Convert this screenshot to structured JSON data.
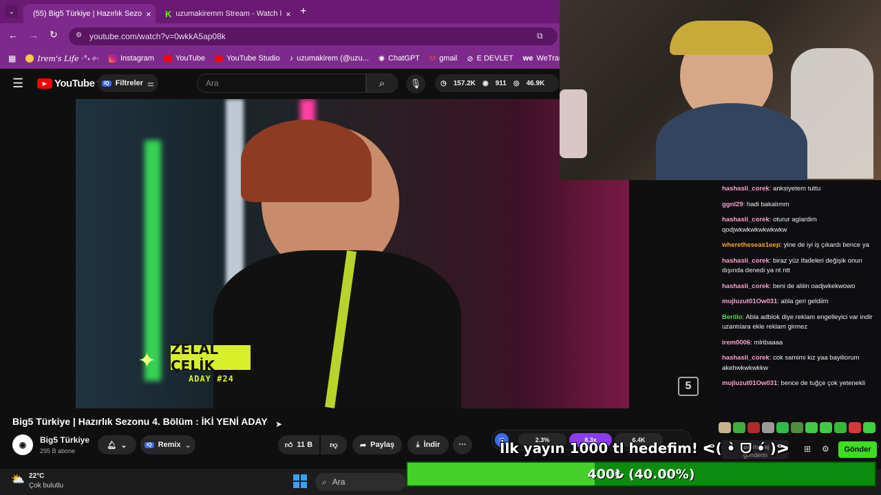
{
  "browser": {
    "tabs": [
      {
        "title": "(55) Big5 Türkiye | Hazırlık Sezo",
        "close": "×"
      },
      {
        "title": "uzumakiremm Stream - Watch l",
        "close": "×"
      }
    ],
    "new_tab": "+",
    "url": "youtube.com/watch?v=0wkkA5ap08k",
    "bookmarks": [
      "Irem's Life ·°˖✧·",
      "Instagram",
      "YouTube",
      "YouTube Studio",
      "uzumakirem (@uzu...",
      "ChatGPT",
      "gmail",
      "E DEVLET",
      "WeTransfe"
    ]
  },
  "youtube": {
    "logo": "YouTube",
    "logo_region": "TR",
    "filters_label": "Filtreler",
    "search_placeholder": "Ara",
    "stats": {
      "likes": "157.2K",
      "views": "911",
      "watching": "46.9K"
    },
    "video": {
      "name_tag": "ZELAL ÇELİK",
      "aday_tag": "ADAY #24",
      "title": "Big5 Türkiye | Hazırlık Sezonu 4. Bölüm : İKİ YENİ ADAY",
      "channel": "Big5 Türkiye",
      "subscribers": "295 B abone",
      "remix": "Remix",
      "like_count": "11 B",
      "share": "Paylaş",
      "download": "İndir",
      "more": "···"
    }
  },
  "overlay_stats": {
    "a": "2.3%",
    "b": "8.3x",
    "c": "6.4K"
  },
  "chat": {
    "messages": [
      {
        "user": "hashasli_corek",
        "text": "anksiyetem tuttu",
        "color": "#ff9fd3"
      },
      {
        "user": "ggnl29",
        "text": "hadi bakalımm",
        "color": "#ff9fd3"
      },
      {
        "user": "hashasli_corek",
        "text": "oturur aglardim qodjwkwkwkwkwkwkw",
        "color": "#ff9fd3"
      },
      {
        "user": "wheretheseas1eep",
        "text": "yine de iyi iş çıkardı bence ya",
        "color": "#f5a623"
      },
      {
        "user": "hashasli_corek",
        "text": "biraz yüz ifadeleri değişik onun dışında denedi ya nt ntt",
        "color": "#ff9fd3"
      },
      {
        "user": "hashasli_corek",
        "text": "beni de aliiin oadjwkekwowo",
        "color": "#ff9fd3"
      },
      {
        "user": "mujluzut01Ow031",
        "text": "abla geri geldiim",
        "color": "#ff9fd3"
      },
      {
        "user": "Berillo",
        "text": "Abla adblok diye reklam engelleyici var indir uzantılara ekle reklam girmez",
        "color": "#52d64a"
      },
      {
        "user": "irem0006",
        "text": "mlribaaaa",
        "color": "#ff9fd3"
      },
      {
        "user": "hashasli_corek",
        "text": "cok samimi kiz yaa bayiliorum akehwkwkwkkw",
        "color": "#ff9fd3"
      },
      {
        "user": "mujluzut01Ow031",
        "text": "bence de tuğçe çok yetenekli",
        "color": "#ff9fd3"
      }
    ],
    "input_placeholder": "Bir mesaj gönderin",
    "send": "Gönder"
  },
  "goal": {
    "text": "İlk yayın 1000 tl hedefim! ᕙ( •̀ ᗜ •́ )ᕗ",
    "progress_label": "400₺ (40.00%)",
    "progress_fraction": 0.4
  },
  "taskbar": {
    "temp": "22°C",
    "weather": "Çok bulutlu",
    "search": "Ara"
  }
}
